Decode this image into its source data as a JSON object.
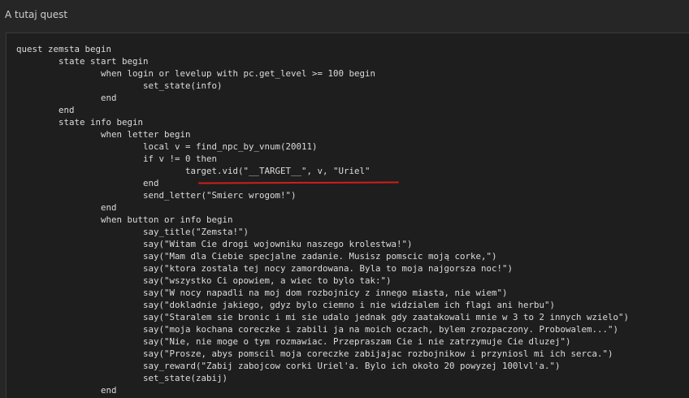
{
  "post": {
    "label": "A tutaj quest"
  },
  "code": {
    "lines": [
      "quest zemsta begin",
      "\tstate start begin",
      "\t\twhen login or levelup with pc.get_level >= 100 begin",
      "\t\t\tset_state(info)",
      "\t\tend",
      "\tend",
      "\tstate info begin",
      "\t\twhen letter begin",
      "\t\t\tlocal v = find_npc_by_vnum(20011)",
      "\t\t\tif v != 0 then",
      "\t\t\t\ttarget.vid(\"__TARGET__\", v, \"Uriel\"",
      "\t\t\tend",
      "\t\t\tsend_letter(\"Smierc wrogom!\")",
      "\t\tend",
      "\t\twhen button or info begin",
      "\t\t\tsay_title(\"Zemsta!\")",
      "\t\t\tsay(\"Witam Cie drogi wojowniku naszego krolestwa!\")",
      "\t\t\tsay(\"Mam dla Ciebie specjalne zadanie. Musisz pomscic moją corke,\")",
      "\t\t\tsay(\"ktora zostala tej nocy zamordowana. Byla to moja najgorsza noc!\")",
      "\t\t\tsay(\"wszystko Ci opowiem, a wiec to bylo tak:\")",
      "\t\t\tsay(\"W nocy napadli na moj dom rozbojnicy z innego miasta, nie wiem\")",
      "\t\t\tsay(\"dokladnie jakiego, gdyz bylo ciemno i nie widzialem ich flagi ani herbu\")",
      "\t\t\tsay(\"Staralem sie bronic i mi sie udalo jednak gdy zaatakowali mnie w 3 to 2 innych wzielo\")",
      "\t\t\tsay(\"moja kochana coreczke i zabili ja na moich oczach, bylem zrozpaczony. Probowalem...\")",
      "\t\t\tsay(\"Nie, nie moge o tym rozmawiac. Przepraszam Cie i nie zatrzymuje Cie dluzej\")",
      "\t\t\tsay(\"Prosze, abys pomscil moja coreczke zabijajac rozbojnikow i przyniosl mi ich serca.\")",
      "\t\t\tsay_reward(\"Zabij zabojcow corki Uriel'a. Bylo ich około 20 powyzej 100lvl'a.\")",
      "\t\t\tset_state(zabij)",
      "\t\tend"
    ],
    "highlight_color": "#d11d1d"
  }
}
